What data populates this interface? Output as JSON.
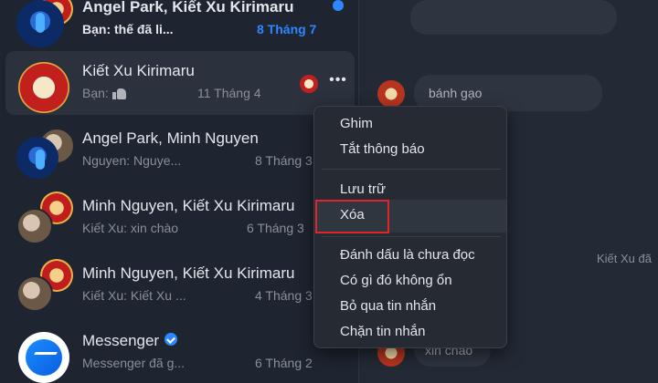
{
  "conversations": [
    {
      "name": "Angel Park, Kiết Xu Kirimaru",
      "preview": "Bạn: thế đã li...",
      "time": "8 Tháng 7"
    },
    {
      "name": "Kiết Xu Kirimaru",
      "preview": "Bạn:",
      "time": "11 Tháng 4"
    },
    {
      "name": "Angel Park, Minh Nguyen",
      "preview": "Nguyen: Nguye...",
      "time": "8 Tháng 3"
    },
    {
      "name": "Minh Nguyen, Kiết Xu Kirimaru",
      "preview": "Kiết Xu: xin chào",
      "time": "6 Tháng 3"
    },
    {
      "name": "Minh Nguyen, Kiết Xu Kirimaru",
      "preview": "Kiết Xu: Kiết Xu ...",
      "time": "4 Tháng 3"
    },
    {
      "name": "Messenger",
      "preview": "Messenger đã g...",
      "time": "6 Tháng 2"
    }
  ],
  "menu": {
    "pin": "Ghim",
    "mute": "Tắt thông báo",
    "archive": "Lưu trữ",
    "delete": "Xóa",
    "mark_unread": "Đánh dấu là chưa đọc",
    "report": "Có gì đó không ổn",
    "ignore": "Bỏ qua tin nhắn",
    "block": "Chặn tin nhắn"
  },
  "more_label": "•••",
  "chat": {
    "top_message": "bánh gạo",
    "sender_label": "Kiết Xu đã",
    "bottom_message": "xin chào"
  },
  "colors": {
    "accent": "#2d88ff",
    "highlight_border": "#e0252a",
    "background": "#1f2530"
  }
}
